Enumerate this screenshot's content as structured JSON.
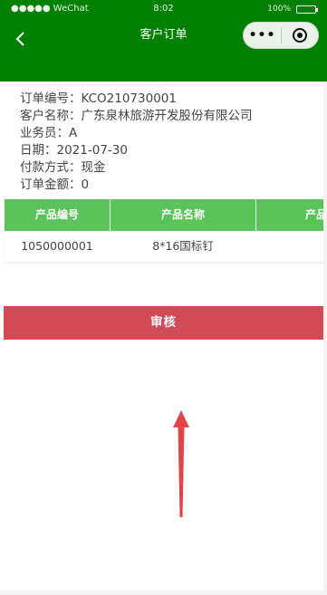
{
  "status_bar": {
    "carrier": "●●●●● WeChat",
    "wifi_icon": "wifi-icon",
    "time": "8:02",
    "battery_text": "100%"
  },
  "nav": {
    "title": "客户订单",
    "back_icon": "back-chevron-icon",
    "more_label": "•••",
    "target_icon": "target-icon"
  },
  "order": {
    "number": "订单编号：KCO210730001",
    "customer": "客户名称：广东泉林旅游开发股份有限公司",
    "salesperson": "业务员：A",
    "date": "日期：2021-07-30",
    "payment": "付款方式：现金",
    "amount": "订单金额：0"
  },
  "table": {
    "headers": [
      "产品编号",
      "产品名称",
      "产品"
    ],
    "rows": [
      [
        "1050000001",
        "8*16国标钉"
      ]
    ]
  },
  "actions": {
    "audit_label": "审核"
  },
  "colors": {
    "nav_green": "#008000",
    "header_green": "#5ac35a",
    "button_red": "#d24a55",
    "annotation_arrow": "#e0454a"
  }
}
